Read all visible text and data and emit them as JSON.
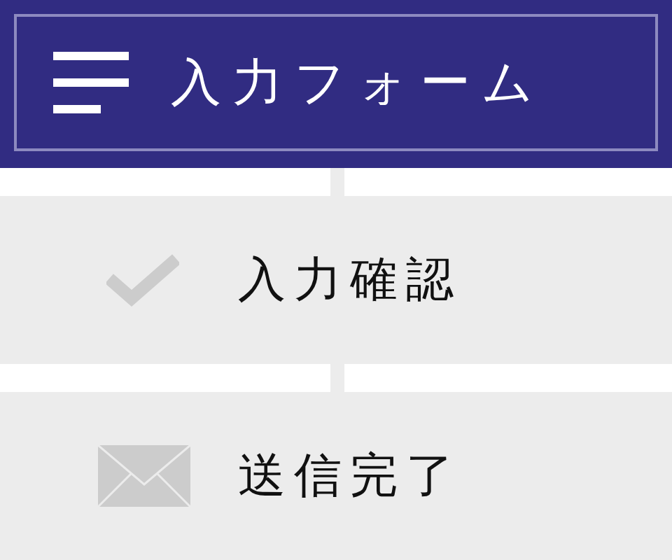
{
  "header": {
    "title": "入力フォーム"
  },
  "steps": [
    {
      "kind": "check",
      "label": "入力確認"
    },
    {
      "kind": "mail",
      "label": "送信完了"
    }
  ]
}
